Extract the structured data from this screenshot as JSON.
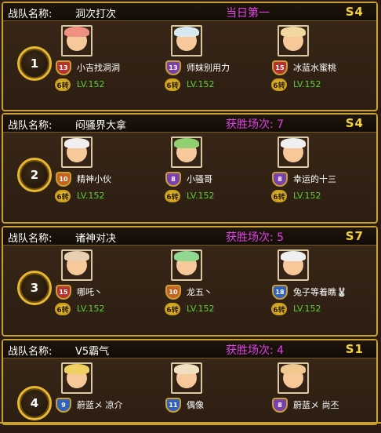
{
  "field_label": "战队名称:",
  "teams": [
    {
      "rank": "1",
      "name": "洞次打次",
      "status": "当日第一",
      "server": "S4",
      "members": [
        {
          "name": "小吉找洞洞",
          "rank_badge": "13",
          "coin": "6转",
          "level": "LV.152",
          "hair": "#f09080"
        },
        {
          "name": "师妹别用力",
          "rank_badge": "13",
          "coin": "6转",
          "level": "LV.152",
          "hair": "#d8e8f0"
        },
        {
          "name": "冰蓝水蜜桃",
          "rank_badge": "15",
          "coin": "6转",
          "level": "LV.152",
          "hair": "#f0d8a0"
        }
      ]
    },
    {
      "rank": "2",
      "name": "闷骚界大拿",
      "status": "获胜场次: 7",
      "server": "S4",
      "members": [
        {
          "name": "精神小伙",
          "rank_badge": "10",
          "coin": "6转",
          "level": "LV.152",
          "hair": "#f0f0f0"
        },
        {
          "name": "小骚哥",
          "rank_badge": "8",
          "coin": "6转",
          "level": "LV.152",
          "hair": "#90d070"
        },
        {
          "name": "幸运的十三",
          "rank_badge": "8",
          "coin": "6转",
          "level": "LV.152",
          "hair": "#f0f0f0"
        }
      ]
    },
    {
      "rank": "3",
      "name": "诸神对决",
      "status": "获胜场次: 5",
      "server": "S7",
      "members": [
        {
          "name": "哪吒丶",
          "rank_badge": "15",
          "coin": "6转",
          "level": "LV.152",
          "hair": "#e8d0b0"
        },
        {
          "name": "龙五丶",
          "rank_badge": "10",
          "coin": "6转",
          "level": "LV.152",
          "hair": "#90d890"
        },
        {
          "name": "兔子等着瞧🐰",
          "rank_badge": "18",
          "coin": "6转",
          "level": "LV.152",
          "hair": "#f0f0f0"
        }
      ]
    },
    {
      "rank": "4",
      "name": "V5霸气",
      "status": "获胜场次: 4",
      "server": "S1",
      "members": [
        {
          "name": "蔚蓝メ 凉介",
          "rank_badge": "9",
          "coin": "",
          "level": "",
          "hair": "#f0d060"
        },
        {
          "name": "偶像",
          "rank_badge": "11",
          "coin": "",
          "level": "",
          "hair": "#f0e0c0"
        },
        {
          "name": "蔚蓝メ 尚丕",
          "rank_badge": "8",
          "coin": "",
          "level": "",
          "hair": "#f0c890"
        }
      ]
    }
  ],
  "colors": {
    "border": "#c8a030",
    "status": "#e040e8",
    "server": "#f4d23c",
    "level": "#58d038"
  }
}
